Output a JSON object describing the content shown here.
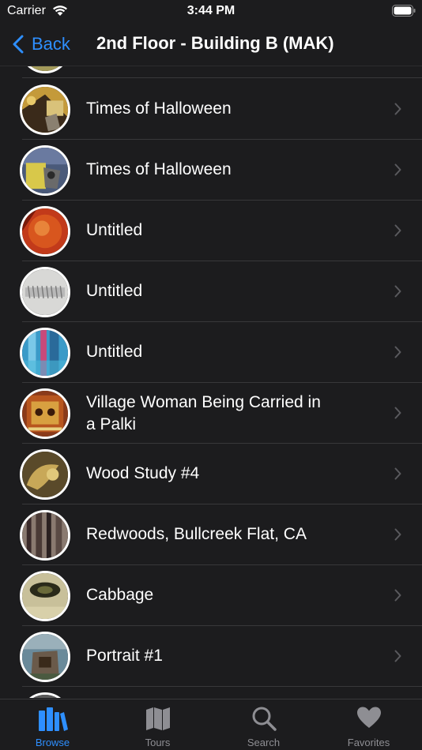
{
  "status_bar": {
    "carrier": "Carrier",
    "time": "3:44 PM"
  },
  "nav": {
    "back_label": "Back",
    "title": "2nd Floor - Building B (MAK)"
  },
  "items": [
    {
      "title": "Times of Halloween"
    },
    {
      "title": "Times of Halloween"
    },
    {
      "title": "Untitled"
    },
    {
      "title": "Untitled"
    },
    {
      "title": "Untitled"
    },
    {
      "title": "Village Woman Being Carried in",
      "title_line2": "a Palki"
    },
    {
      "title": "Wood Study #4"
    },
    {
      "title": "Redwoods, Bullcreek Flat, CA"
    },
    {
      "title": "Cabbage"
    },
    {
      "title": "Portrait #1"
    }
  ],
  "tabs": [
    {
      "label": "Browse",
      "icon": "books-icon",
      "active": true
    },
    {
      "label": "Tours",
      "icon": "map-icon"
    },
    {
      "label": "Search",
      "icon": "search-icon"
    },
    {
      "label": "Favorites",
      "icon": "heart-icon"
    }
  ],
  "colors": {
    "accent": "#2e8fff",
    "background": "#1c1c1e",
    "separator": "#38383a",
    "inactive": "#8e8e93"
  }
}
